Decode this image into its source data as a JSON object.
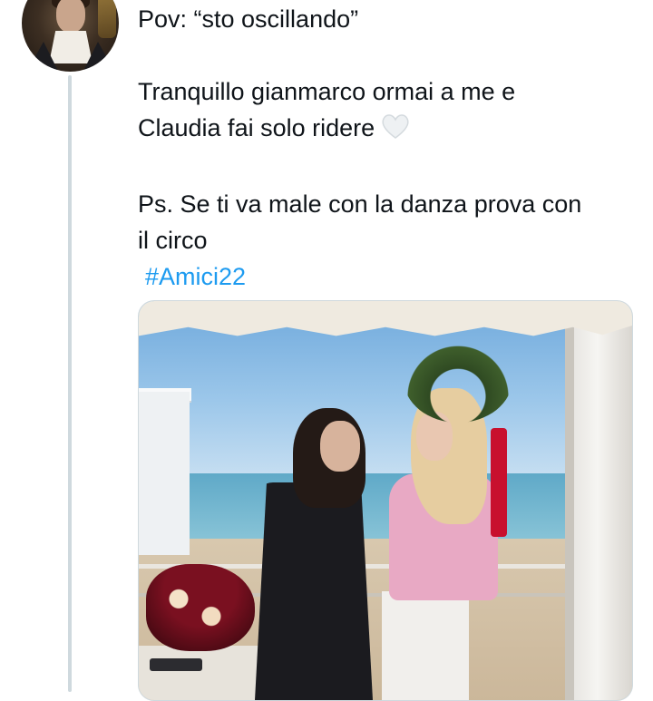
{
  "author": {
    "avatar_icon": "avatar-portrait"
  },
  "tweet": {
    "line1": "Pov: “sto oscillando”",
    "para2_line1": "Tranquillo gianmarco ormai a me e",
    "para2_line2": "Claudia fai solo ridere",
    "heart_emoji": "white-heart-icon",
    "para3_line1": "Ps. Se ti va male con la danza prova con",
    "para3_line2": "il circo",
    "hashtag": "#Amici22"
  },
  "colors": {
    "link": "#1d9bf0",
    "text": "#0f1419",
    "thread_line": "#cfd9de"
  },
  "media": {
    "type": "photo"
  }
}
